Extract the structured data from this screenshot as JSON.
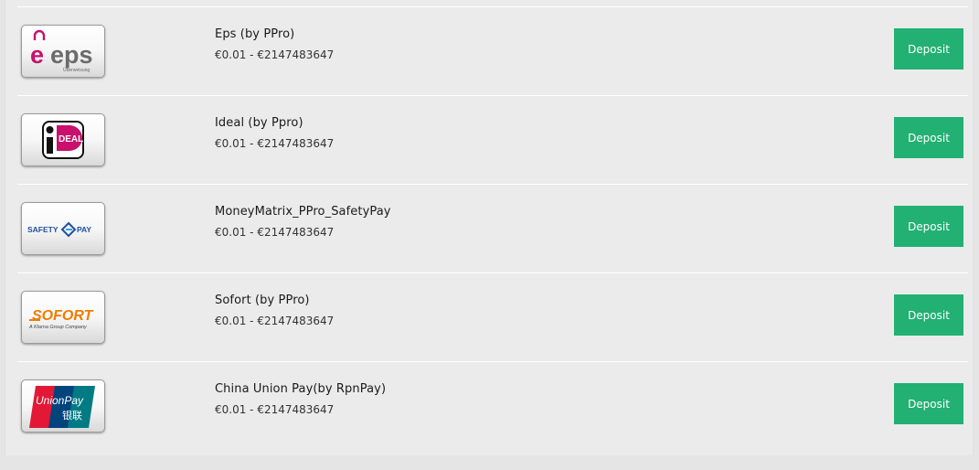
{
  "methods": [
    {
      "logo": "eps-logo",
      "logo_text": "eps",
      "logo_subtext": "Überweisung",
      "name": "Eps (by PPro)",
      "range": "€0.01 - €2147483647",
      "button": "Deposit"
    },
    {
      "logo": "ideal-logo",
      "logo_text": "iDEAL",
      "name": "Ideal (by Ppro)",
      "range": "€0.01 - €2147483647",
      "button": "Deposit"
    },
    {
      "logo": "safetypay-logo",
      "logo_text": "SAFETYPAY",
      "name": "MoneyMatrix_PPro_SafetyPay",
      "range": "€0.01 - €2147483647",
      "button": "Deposit"
    },
    {
      "logo": "sofort-logo",
      "logo_text": "SOFORT",
      "logo_subtext": "A Klarna Group Company",
      "name": "Sofort (by PPro)",
      "range": "€0.01 - €2147483647",
      "button": "Deposit"
    },
    {
      "logo": "unionpay-logo",
      "logo_text": "UnionPay",
      "logo_subtext": "银联",
      "name": "China Union Pay(by RpnPay)",
      "range": "€0.01 - €2147483647",
      "button": "Deposit"
    }
  ],
  "colors": {
    "deposit_button": "#22b073",
    "panel_background": "#ebebeb"
  }
}
